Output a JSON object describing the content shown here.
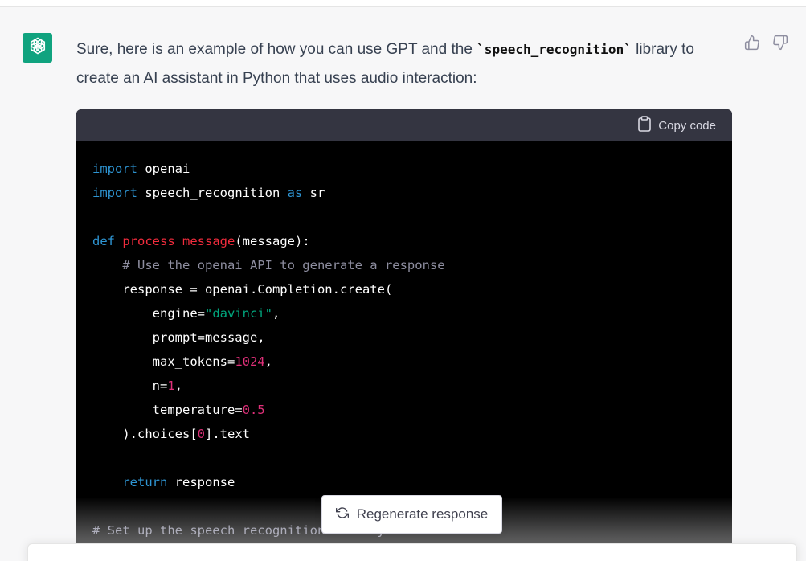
{
  "message": {
    "text_before": "Sure, here is an example of how you can use GPT and the ",
    "inline_code": "`speech_recognition`",
    "text_after": " library to create an AI assistant in Python that uses audio interaction:"
  },
  "code_block": {
    "copy_label": "Copy code",
    "lines": [
      [
        {
          "t": "import",
          "c": "kw"
        },
        {
          "t": " openai",
          "c": ""
        }
      ],
      [
        {
          "t": "import",
          "c": "kw"
        },
        {
          "t": " speech_recognition ",
          "c": ""
        },
        {
          "t": "as",
          "c": "kw"
        },
        {
          "t": " sr",
          "c": ""
        }
      ],
      [],
      [
        {
          "t": "def",
          "c": "kw"
        },
        {
          "t": " ",
          "c": ""
        },
        {
          "t": "process_message",
          "c": "fn"
        },
        {
          "t": "(message):",
          "c": ""
        }
      ],
      [
        {
          "t": "    # Use the openai API to generate a response",
          "c": "cm"
        }
      ],
      [
        {
          "t": "    response = openai.Completion.create(",
          "c": ""
        }
      ],
      [
        {
          "t": "        engine=",
          "c": ""
        },
        {
          "t": "\"davinci\"",
          "c": "str"
        },
        {
          "t": ",",
          "c": ""
        }
      ],
      [
        {
          "t": "        prompt=message,",
          "c": ""
        }
      ],
      [
        {
          "t": "        max_tokens=",
          "c": ""
        },
        {
          "t": "1024",
          "c": "num"
        },
        {
          "t": ",",
          "c": ""
        }
      ],
      [
        {
          "t": "        n=",
          "c": ""
        },
        {
          "t": "1",
          "c": "num"
        },
        {
          "t": ",",
          "c": ""
        }
      ],
      [
        {
          "t": "        temperature=",
          "c": ""
        },
        {
          "t": "0.5",
          "c": "num"
        }
      ],
      [
        {
          "t": "    ).choices[",
          "c": ""
        },
        {
          "t": "0",
          "c": "num"
        },
        {
          "t": "].text",
          "c": ""
        }
      ],
      [],
      [
        {
          "t": "    ",
          "c": ""
        },
        {
          "t": "return",
          "c": "kw"
        },
        {
          "t": " response",
          "c": ""
        }
      ],
      [],
      [
        {
          "t": "# Set up the speech recognition library",
          "c": "cm"
        }
      ]
    ]
  },
  "regenerate": {
    "label": "Regenerate response"
  },
  "colors": {
    "accent": "#10a37f",
    "code_bg": "#000000",
    "header_bg": "#343541"
  },
  "icons": {
    "avatar": "openai-logo-icon",
    "up": "thumbs-up-icon",
    "down": "thumbs-down-icon",
    "copy": "clipboard-icon",
    "regen": "refresh-icon"
  }
}
